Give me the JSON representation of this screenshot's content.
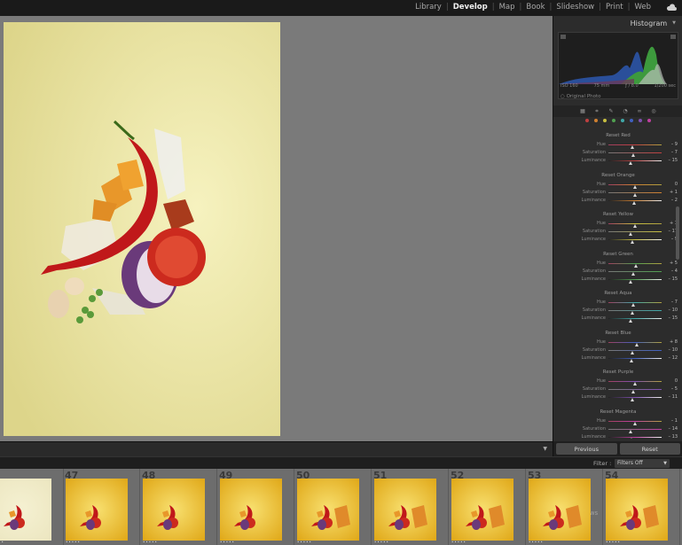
{
  "header": {
    "modules": [
      "Library",
      "Develop",
      "Map",
      "Book",
      "Slideshow",
      "Print",
      "Web"
    ],
    "active_module": "Develop"
  },
  "panel": {
    "histogram_title": "Histogram",
    "histogram_meta": [
      "ISO 160",
      "75 mm",
      "ƒ / 8.0",
      "1/200 sec"
    ],
    "original_photo": "Original Photo",
    "hsl_groups": [
      {
        "title": "Reset Red",
        "rows": [
          {
            "label": "Hue",
            "value": "– 9",
            "pos": 0.45
          },
          {
            "label": "Saturation",
            "value": "– 7",
            "pos": 0.47
          },
          {
            "label": "Luminance",
            "value": "– 15",
            "pos": 0.43
          }
        ],
        "track_color": "#c04040"
      },
      {
        "title": "Reset Orange",
        "rows": [
          {
            "label": "Hue",
            "value": "0",
            "pos": 0.5
          },
          {
            "label": "Saturation",
            "value": "+ 1",
            "pos": 0.51
          },
          {
            "label": "Luminance",
            "value": "– 2",
            "pos": 0.49
          }
        ],
        "track_color": "#d08030"
      },
      {
        "title": "Reset Yellow",
        "rows": [
          {
            "label": "Hue",
            "value": "+ 1",
            "pos": 0.51
          },
          {
            "label": "Saturation",
            "value": "– 17",
            "pos": 0.42
          },
          {
            "label": "Luminance",
            "value": "– 9",
            "pos": 0.45
          }
        ],
        "track_color": "#c8c040"
      },
      {
        "title": "Reset Green",
        "rows": [
          {
            "label": "Hue",
            "value": "+ 5",
            "pos": 0.53
          },
          {
            "label": "Saturation",
            "value": "– 4",
            "pos": 0.48
          },
          {
            "label": "Luminance",
            "value": "– 15",
            "pos": 0.43
          }
        ],
        "track_color": "#50a050"
      },
      {
        "title": "Reset Aqua",
        "rows": [
          {
            "label": "Hue",
            "value": "– 7",
            "pos": 0.47
          },
          {
            "label": "Saturation",
            "value": "– 10",
            "pos": 0.45
          },
          {
            "label": "Luminance",
            "value": "– 15",
            "pos": 0.43
          }
        ],
        "track_color": "#40a8a8"
      },
      {
        "title": "Reset Blue",
        "rows": [
          {
            "label": "Hue",
            "value": "+ 8",
            "pos": 0.54
          },
          {
            "label": "Saturation",
            "value": "– 10",
            "pos": 0.45
          },
          {
            "label": "Luminance",
            "value": "– 12",
            "pos": 0.44
          }
        ],
        "track_color": "#4060c0"
      },
      {
        "title": "Reset Purple",
        "rows": [
          {
            "label": "Hue",
            "value": "0",
            "pos": 0.5
          },
          {
            "label": "Saturation",
            "value": "– 5",
            "pos": 0.48
          },
          {
            "label": "Luminance",
            "value": "– 11",
            "pos": 0.45
          }
        ],
        "track_color": "#8050b0"
      },
      {
        "title": "Reset Magenta",
        "rows": [
          {
            "label": "Hue",
            "value": "– 1",
            "pos": 0.5
          },
          {
            "label": "Saturation",
            "value": "– 14",
            "pos": 0.43
          },
          {
            "label": "Luminance",
            "value": "– 13",
            "pos": 0.44
          }
        ],
        "track_color": "#c040a0"
      }
    ],
    "previous_label": "Previous",
    "reset_label": "Reset"
  },
  "filter": {
    "label": "Filter :",
    "value": "Filters Off"
  },
  "filmstrip": {
    "numbers": [
      "",
      "47",
      "48",
      "49",
      "50",
      "51",
      "52",
      "53",
      "54"
    ]
  },
  "colors": {
    "accent": "#f0f0f0",
    "workspace_bg": "#7a7a7a",
    "photo_bg": "#e8e29a"
  }
}
